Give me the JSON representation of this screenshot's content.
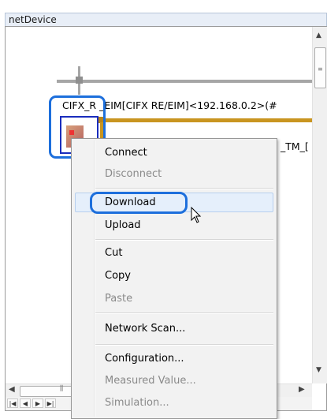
{
  "panel": {
    "title": "netDevice"
  },
  "canvas": {
    "device_label": "CIFX_R   _EIM[CIFX RE/EIM]<192.168.0.2>(#",
    "tm_label": "_TM_["
  },
  "context_menu": {
    "items": [
      {
        "label": "Connect",
        "enabled": true
      },
      {
        "label": "Disconnect",
        "enabled": false
      },
      {
        "label": "Download",
        "enabled": true,
        "hovered": true
      },
      {
        "label": "Upload",
        "enabled": true
      },
      {
        "label": "Cut",
        "enabled": true
      },
      {
        "label": "Copy",
        "enabled": true
      },
      {
        "label": "Paste",
        "enabled": false
      },
      {
        "label": "Network Scan...",
        "enabled": true
      },
      {
        "label": "Configuration...",
        "enabled": true
      },
      {
        "label": "Measured Value...",
        "enabled": false
      },
      {
        "label": "Simulation...",
        "enabled": false
      }
    ]
  },
  "colors": {
    "highlight": "#1d6fdc",
    "gold_bus": "#c99520",
    "gray_bus": "#a6a6a6",
    "menu_bg": "#f2f2f2",
    "disabled_text": "#8a8a8a"
  },
  "icons": {
    "cursor": "arrow-cursor-icon",
    "scroll_up": "arrow-up-icon",
    "scroll_down": "arrow-down-icon",
    "scroll_left": "arrow-left-icon",
    "scroll_right": "arrow-right-icon",
    "scroll_grip": "grip-icon"
  }
}
